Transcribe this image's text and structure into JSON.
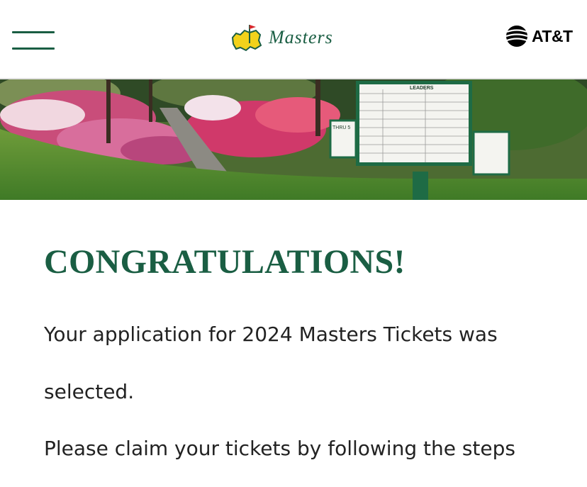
{
  "header": {
    "menu_icon": "hamburger-menu-icon",
    "logo_text": "Masters",
    "sponsor_text": "AT&T",
    "sponsor_icon": "att-globe-icon"
  },
  "banner": {
    "leaderboard_title": "LEADERS",
    "thru_label": "THRU 5"
  },
  "main": {
    "title": "CONGRATULATIONS!",
    "line1": "Your application for 2024 Masters Tickets was",
    "line2": "selected.",
    "line3": "Please claim your tickets by following the steps"
  },
  "colors": {
    "brand_green": "#1a5e43",
    "flag_red": "#d6262b",
    "logo_yellow": "#f2d21b"
  }
}
